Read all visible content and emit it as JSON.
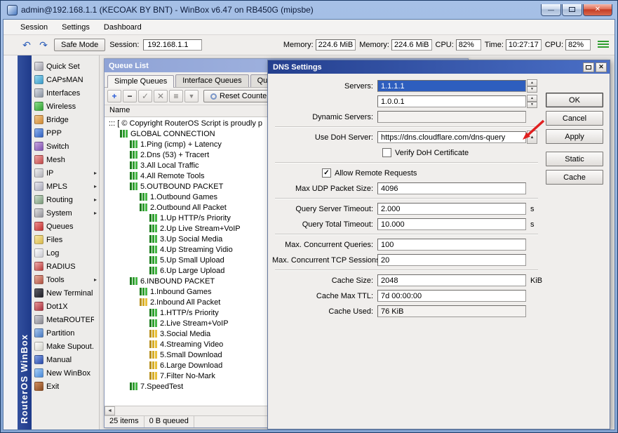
{
  "icons": {
    "undo": "↶",
    "redo": "↷",
    "minimize": "—",
    "close": "✕",
    "up_arrow": "▲",
    "down_arrow": "▼",
    "left_arrow": "◄",
    "right_arrow": "►",
    "check": "✓"
  },
  "window": {
    "title": "admin@192.168.1.1 (KECOAK BY BNT) - WinBox v6.47 on RB450G (mipsbe)",
    "brand_vertical": "RouterOS WinBox"
  },
  "menu": {
    "items": [
      {
        "label": "Session"
      },
      {
        "label": "Settings"
      },
      {
        "label": "Dashboard"
      }
    ]
  },
  "toolbar": {
    "safe_mode_label": "Safe Mode",
    "session_label": "Session:",
    "session_value": "192.168.1.1",
    "stats": [
      {
        "label": "Memory:",
        "value": "224.6 MiB"
      },
      {
        "label": "Memory:",
        "value": "224.6 MiB"
      },
      {
        "label": "CPU:",
        "value": "82%"
      },
      {
        "label": "Time:",
        "value": "10:27:17"
      },
      {
        "label": "CPU:",
        "value": "82%"
      }
    ]
  },
  "sidebar": {
    "items": [
      {
        "label": "Quick Set",
        "icon": "quickset-icon",
        "iconclass": "ic-quickset",
        "arrow": ""
      },
      {
        "label": "CAPsMAN",
        "icon": "capsman-icon",
        "iconclass": "ic-capsman",
        "arrow": ""
      },
      {
        "label": "Interfaces",
        "icon": "interfaces-icon",
        "iconclass": "ic-interfaces",
        "arrow": ""
      },
      {
        "label": "Wireless",
        "icon": "wireless-icon",
        "iconclass": "ic-wireless",
        "arrow": ""
      },
      {
        "label": "Bridge",
        "icon": "bridge-icon",
        "iconclass": "ic-bridge",
        "arrow": ""
      },
      {
        "label": "PPP",
        "icon": "ppp-icon",
        "iconclass": "ic-ppp",
        "arrow": ""
      },
      {
        "label": "Switch",
        "icon": "switch-icon",
        "iconclass": "ic-switch",
        "arrow": ""
      },
      {
        "label": "Mesh",
        "icon": "mesh-icon",
        "iconclass": "ic-mesh",
        "arrow": ""
      },
      {
        "label": "IP",
        "icon": "ip-icon",
        "iconclass": "ic-ip",
        "arrow": "▸"
      },
      {
        "label": "MPLS",
        "icon": "mpls-icon",
        "iconclass": "ic-mpls",
        "arrow": "▸"
      },
      {
        "label": "Routing",
        "icon": "routing-icon",
        "iconclass": "ic-routing",
        "arrow": "▸"
      },
      {
        "label": "System",
        "icon": "system-icon",
        "iconclass": "ic-system",
        "arrow": "▸"
      },
      {
        "label": "Queues",
        "icon": "queues-icon",
        "iconclass": "ic-queues",
        "arrow": ""
      },
      {
        "label": "Files",
        "icon": "files-icon",
        "iconclass": "ic-files",
        "arrow": ""
      },
      {
        "label": "Log",
        "icon": "log-icon",
        "iconclass": "ic-log",
        "arrow": ""
      },
      {
        "label": "RADIUS",
        "icon": "radius-icon",
        "iconclass": "ic-radius",
        "arrow": ""
      },
      {
        "label": "Tools",
        "icon": "tools-icon",
        "iconclass": "ic-tools",
        "arrow": "▸"
      },
      {
        "label": "New Terminal",
        "icon": "terminal-icon",
        "iconclass": "ic-terminal",
        "arrow": ""
      },
      {
        "label": "Dot1X",
        "icon": "dot1x-icon",
        "iconclass": "ic-dot1x",
        "arrow": ""
      },
      {
        "label": "MetaROUTER",
        "icon": "metarouter-icon",
        "iconclass": "ic-metarouter",
        "arrow": ""
      },
      {
        "label": "Partition",
        "icon": "partition-icon",
        "iconclass": "ic-partition",
        "arrow": ""
      },
      {
        "label": "Make Supout.rif",
        "icon": "supout-icon",
        "iconclass": "ic-supout",
        "arrow": ""
      },
      {
        "label": "Manual",
        "icon": "manual-icon",
        "iconclass": "ic-manual",
        "arrow": ""
      },
      {
        "label": "New WinBox",
        "icon": "newwinbox-icon",
        "iconclass": "ic-newwinbox",
        "arrow": ""
      },
      {
        "label": "Exit",
        "icon": "exit-icon",
        "iconclass": "ic-exit",
        "arrow": ""
      }
    ]
  },
  "queue_list": {
    "title": "Queue List",
    "tabs": [
      {
        "label": "Simple Queues",
        "state": "active"
      },
      {
        "label": "Interface Queues",
        "state": ""
      },
      {
        "label": "Queue Tree",
        "state": ""
      }
    ],
    "toolbar_icons": [
      {
        "name": "add-icon",
        "glyph": "+",
        "cls": "t-add"
      },
      {
        "name": "remove-icon",
        "glyph": "−",
        "cls": "t-remove"
      },
      {
        "name": "enable-icon",
        "glyph": "✓",
        "cls": "t-dim"
      },
      {
        "name": "disable-icon",
        "glyph": "✕",
        "cls": "t-dim"
      },
      {
        "name": "comment-icon",
        "glyph": "≡",
        "cls": "t-comment"
      },
      {
        "name": "filter-icon",
        "glyph": "▼",
        "cls": "t-filter"
      }
    ],
    "reset_label": "Reset Counters",
    "columns": [
      {
        "label": "Name"
      }
    ],
    "rows": [
      {
        "text": "::: [ © Copyright RouterOS Script is proudly p",
        "lvclass": "lv0",
        "iconclass": "qic-none"
      },
      {
        "text": "GLOBAL CONNECTION",
        "lvclass": "lv1",
        "iconclass": "qic-green"
      },
      {
        "text": "1.Ping (icmp) + Latency",
        "lvclass": "lv2",
        "iconclass": "qic-green"
      },
      {
        "text": "2.Dns (53) + Tracert",
        "lvclass": "lv2",
        "iconclass": "qic-green"
      },
      {
        "text": "3.All Local Traffic",
        "lvclass": "lv2",
        "iconclass": "qic-green"
      },
      {
        "text": "4.All Remote Tools",
        "lvclass": "lv2",
        "iconclass": "qic-green"
      },
      {
        "text": "5.OUTBOUND PACKET",
        "lvclass": "lv2",
        "iconclass": "qic-green"
      },
      {
        "text": "1.Outbound Games",
        "lvclass": "lv3",
        "iconclass": "qic-green"
      },
      {
        "text": "2.Outbound All Packet",
        "lvclass": "lv3",
        "iconclass": "qic-green"
      },
      {
        "text": "1.Up HTTP/s Priority",
        "lvclass": "lv4",
        "iconclass": "qic-green"
      },
      {
        "text": "2.Up Live Stream+VoIP",
        "lvclass": "lv4",
        "iconclass": "qic-green"
      },
      {
        "text": "3.Up Social Media",
        "lvclass": "lv4",
        "iconclass": "qic-green"
      },
      {
        "text": "4.Up Streaming Vidio",
        "lvclass": "lv4",
        "iconclass": "qic-green"
      },
      {
        "text": "5.Up Small Upload",
        "lvclass": "lv4",
        "iconclass": "qic-green"
      },
      {
        "text": "6.Up Large Upload",
        "lvclass": "lv4",
        "iconclass": "qic-green"
      },
      {
        "text": "6.INBOUND PACKET",
        "lvclass": "lv2",
        "iconclass": "qic-green"
      },
      {
        "text": "1.Inbound Games",
        "lvclass": "lv3",
        "iconclass": "qic-green"
      },
      {
        "text": "2.Inbound All Packet",
        "lvclass": "lv3",
        "iconclass": "qic-yellow"
      },
      {
        "text": "1.HTTP/s Priority",
        "lvclass": "lv4",
        "iconclass": "qic-green"
      },
      {
        "text": "2.Live Stream+VoIP",
        "lvclass": "lv4",
        "iconclass": "qic-green"
      },
      {
        "text": "3.Social Media",
        "lvclass": "lv4",
        "iconclass": "qic-yellow"
      },
      {
        "text": "4.Streaming Video",
        "lvclass": "lv4",
        "iconclass": "qic-yellow"
      },
      {
        "text": "5.Small Download",
        "lvclass": "lv4",
        "iconclass": "qic-yellow"
      },
      {
        "text": "6.Large Download",
        "lvclass": "lv4",
        "iconclass": "qic-yellow"
      },
      {
        "text": "7.Filter No-Mark",
        "lvclass": "lv4",
        "iconclass": "qic-yellow"
      },
      {
        "text": "7.SpeedTest",
        "lvclass": "lv2",
        "iconclass": "qic-green"
      }
    ],
    "status": [
      {
        "label": "25 items"
      },
      {
        "label": "0 B queued"
      }
    ]
  },
  "dns": {
    "title": "DNS Settings",
    "labels": {
      "servers": "Servers:",
      "dynamic_servers": "Dynamic Servers:",
      "use_doh_server": "Use DoH Server:",
      "verify_doh": "Verify DoH Certificate",
      "allow_remote": "Allow Remote Requests",
      "max_udp": "Max UDP Packet Size:",
      "query_server_timeout": "Query Server Timeout:",
      "query_total_timeout": "Query Total Timeout:",
      "max_concurrent_queries": "Max. Concurrent Queries:",
      "max_concurrent_tcp": "Max. Concurrent TCP Sessions:",
      "cache_size": "Cache Size:",
      "cache_max_ttl": "Cache Max TTL:",
      "cache_used": "Cache Used:"
    },
    "values": {
      "server1": "1.1.1.1",
      "server2": "1.0.0.1",
      "dynamic_servers": "",
      "doh_server": "https://dns.cloudflare.com/dns-query",
      "max_udp": "4096",
      "query_server_timeout": "2.000",
      "query_server_timeout_suffix": "s",
      "query_total_timeout": "10.000",
      "query_total_timeout_suffix": "s",
      "max_concurrent_queries": "100",
      "max_concurrent_tcp": "20",
      "cache_size": "2048",
      "cache_size_suffix": "KiB",
      "cache_max_ttl": "7d 00:00:00",
      "cache_used": "76 KiB"
    },
    "checkboxes": {
      "verify_doh_checked": "",
      "allow_remote_checked": "✓"
    },
    "action_buttons": [
      {
        "label": "OK",
        "cls": "btn-ok"
      },
      {
        "label": "Cancel",
        "cls": ""
      },
      {
        "label": "Apply",
        "cls": ""
      }
    ],
    "side_buttons": [
      {
        "label": "Static",
        "cls": "btn-gap"
      },
      {
        "label": "Cache",
        "cls": ""
      }
    ],
    "annotation_color": "#e02020"
  }
}
